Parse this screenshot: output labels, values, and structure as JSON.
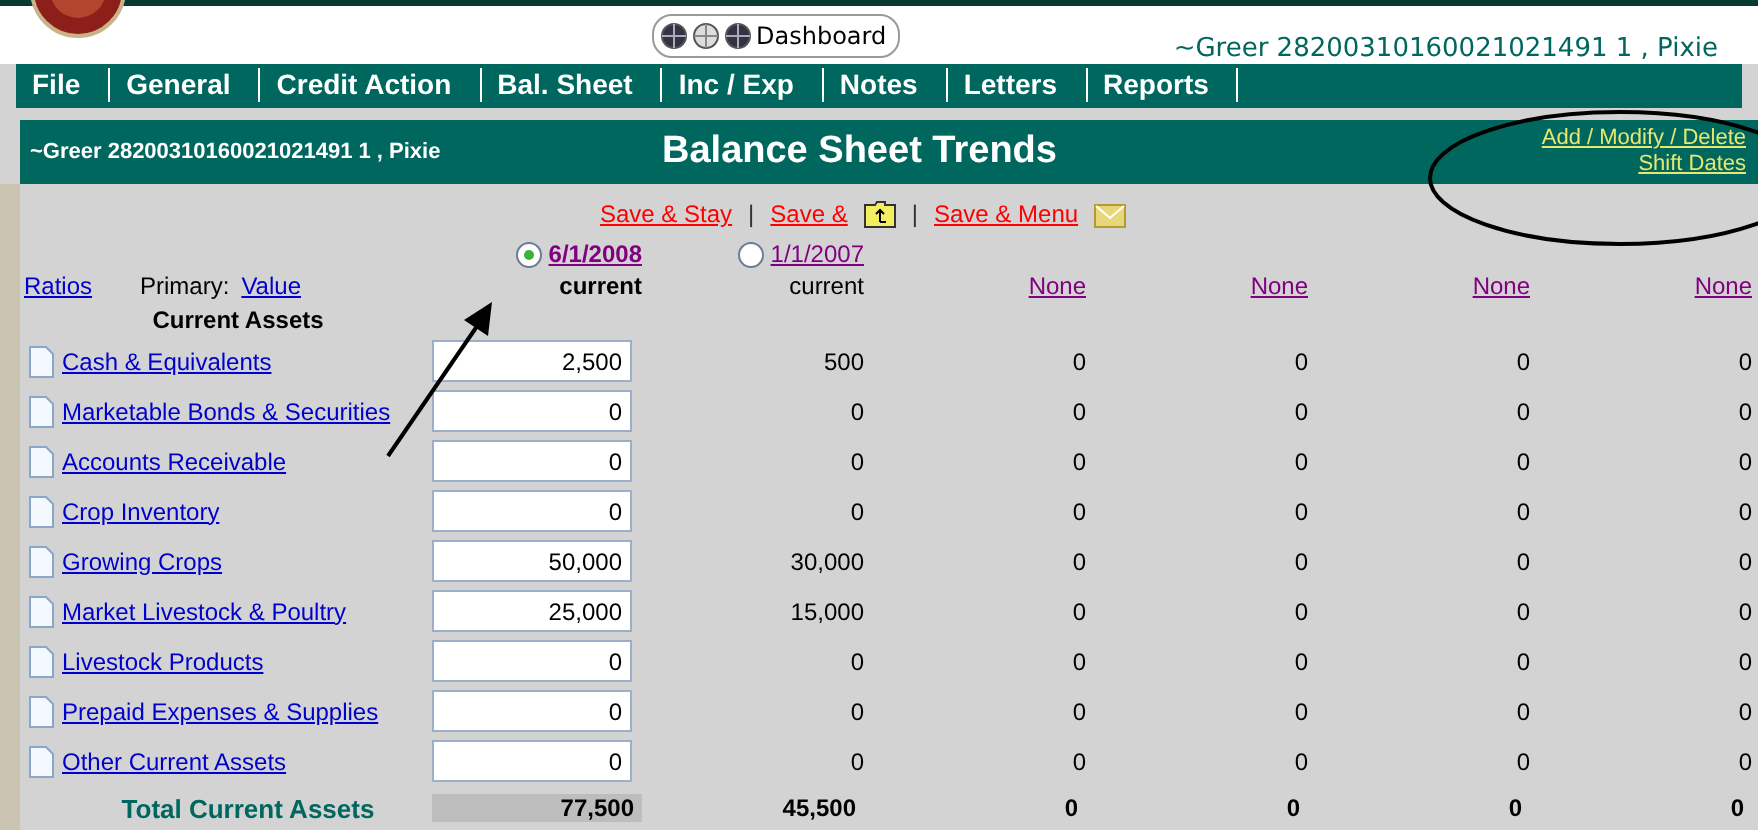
{
  "header": {
    "dashboard": "Dashboard",
    "user": "~Greer 28200310160021021491 1 , Pixie"
  },
  "menu": [
    "File",
    "General",
    "Credit Action",
    "Bal. Sheet",
    "Inc / Exp",
    "Notes",
    "Letters",
    "Reports"
  ],
  "title_bar": {
    "client": "~Greer 28200310160021021491 1 , Pixie",
    "title": "Balance Sheet Trends",
    "links": [
      "Add / Modify / Delete",
      "Shift Dates"
    ]
  },
  "action_separator": "|",
  "actions": [
    {
      "label": "Save & Stay",
      "kind": "plain"
    },
    {
      "label": "Save &",
      "kind": "folder"
    },
    {
      "label": "Save & Menu",
      "kind": "mail"
    }
  ],
  "ratios": "Ratios",
  "primary_label": "Primary:",
  "primary_value": "Value",
  "date_columns": [
    {
      "date": "6/1/2008",
      "selected": true,
      "status": "current"
    },
    {
      "date": "1/1/2007",
      "selected": false,
      "status": "current"
    }
  ],
  "empty_columns": [
    "None",
    "None",
    "None",
    "None"
  ],
  "section": "Current Assets",
  "rows": [
    {
      "label": "Cash & Equivalents",
      "value": "2,500",
      "values": [
        "500",
        "0",
        "0",
        "0",
        "0"
      ]
    },
    {
      "label": "Marketable Bonds & Securities",
      "value": "0",
      "values": [
        "0",
        "0",
        "0",
        "0",
        "0"
      ]
    },
    {
      "label": "Accounts Receivable",
      "value": "0",
      "values": [
        "0",
        "0",
        "0",
        "0",
        "0"
      ]
    },
    {
      "label": "Crop Inventory",
      "value": "0",
      "values": [
        "0",
        "0",
        "0",
        "0",
        "0"
      ]
    },
    {
      "label": "Growing Crops",
      "value": "50,000",
      "values": [
        "30,000",
        "0",
        "0",
        "0",
        "0"
      ]
    },
    {
      "label": "Market Livestock & Poultry",
      "value": "25,000",
      "values": [
        "15,000",
        "0",
        "0",
        "0",
        "0"
      ]
    },
    {
      "label": "Livestock Products",
      "value": "0",
      "values": [
        "0",
        "0",
        "0",
        "0",
        "0"
      ]
    },
    {
      "label": "Prepaid Expenses & Supplies",
      "value": "0",
      "values": [
        "0",
        "0",
        "0",
        "0",
        "0"
      ]
    },
    {
      "label": "Other Current Assets",
      "value": "0",
      "values": [
        "0",
        "0",
        "0",
        "0",
        "0"
      ]
    }
  ],
  "total": {
    "label": "Total Current Assets",
    "values": [
      "77,500",
      "45,500",
      "0",
      "0",
      "0",
      "0"
    ]
  }
}
